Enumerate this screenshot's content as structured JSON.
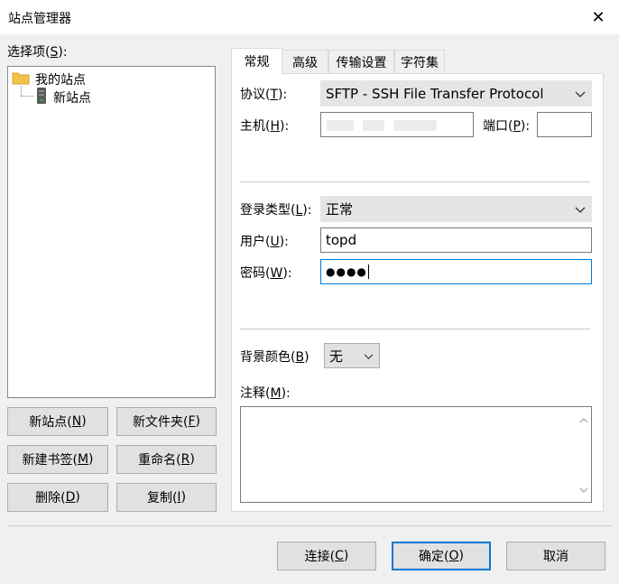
{
  "window": {
    "title": "站点管理器",
    "close_glyph": "✕"
  },
  "tree": {
    "label_prefix": "选择项(",
    "label_key": "S",
    "label_suffix": "):",
    "root": {
      "label": "我的站点",
      "icon": "folder-icon"
    },
    "child": {
      "label": "新站点",
      "icon": "server-icon"
    }
  },
  "left_buttons": {
    "new_site": {
      "pre": "新站点(",
      "key": "N",
      "post": ")"
    },
    "new_folder": {
      "pre": "新文件夹(",
      "key": "F",
      "post": ")"
    },
    "new_bookmark": {
      "pre": "新建书签(",
      "key": "M",
      "post": ")"
    },
    "rename": {
      "pre": "重命名(",
      "key": "R",
      "post": ")"
    },
    "delete": {
      "pre": "删除(",
      "key": "D",
      "post": ")"
    },
    "copy": {
      "pre": "复制(",
      "key": "I",
      "post": ")"
    }
  },
  "tabs": [
    {
      "label": "常规",
      "active": true
    },
    {
      "label": "高级",
      "active": false
    },
    {
      "label": "传输设置",
      "active": false
    },
    {
      "label": "字符集",
      "active": false
    }
  ],
  "general": {
    "protocol": {
      "pre": "协议(",
      "key": "T",
      "post": "):",
      "value": "SFTP - SSH File Transfer Protocol"
    },
    "host": {
      "pre": "主机(",
      "key": "H",
      "post": "):",
      "value": ""
    },
    "port": {
      "pre": "端口(",
      "key": "P",
      "post": "):",
      "value": ""
    },
    "logon_type": {
      "pre": "登录类型(",
      "key": "L",
      "post": "):",
      "value": "正常"
    },
    "user": {
      "pre": "用户(",
      "key": "U",
      "post": "):",
      "value": "topd"
    },
    "password": {
      "pre": "密码(",
      "key": "W",
      "post": "):",
      "value": "●●●●"
    },
    "background_color": {
      "pre": "背景颜色(",
      "key": "B",
      "post": ")",
      "value": "无"
    },
    "comments": {
      "pre": "注释(",
      "key": "M",
      "post": "):",
      "value": ""
    }
  },
  "footer_buttons": {
    "connect": {
      "pre": "连接(",
      "key": "C",
      "post": ")"
    },
    "ok": {
      "pre": "确定(",
      "key": "O",
      "post": ")"
    },
    "cancel": {
      "label": "取消"
    }
  },
  "colors": {
    "focus_border": "#0078d7",
    "folder": "#f4c14a",
    "server": "#5a5a5a",
    "server_led": "#22b14c"
  }
}
